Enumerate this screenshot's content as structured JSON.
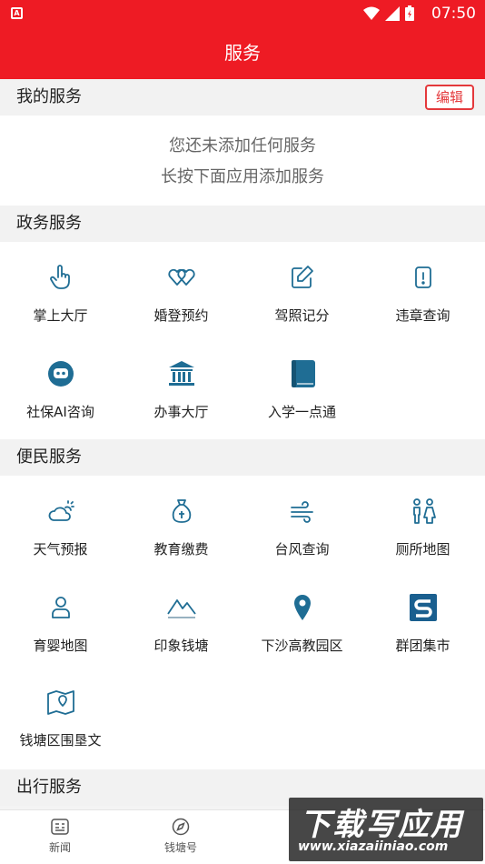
{
  "status_bar": {
    "time": "07:50",
    "sim_glyph": "A"
  },
  "header": {
    "title": "服务"
  },
  "my_services": {
    "title": "我的服务",
    "edit_label": "编辑",
    "empty_line1": "您还未添加任何服务",
    "empty_line2": "长按下面应用添加服务"
  },
  "gov_services": {
    "title": "政务服务",
    "items": [
      {
        "label": "掌上大厅",
        "icon": "hand-pointer-icon"
      },
      {
        "label": "婚登预约",
        "icon": "double-heart-icon"
      },
      {
        "label": "驾照记分",
        "icon": "edit-note-icon"
      },
      {
        "label": "违章查询",
        "icon": "alert-card-icon"
      },
      {
        "label": "社保AI咨询",
        "icon": "robot-icon"
      },
      {
        "label": "办事大厅",
        "icon": "government-building-icon"
      },
      {
        "label": "入学一点通",
        "icon": "book-icon"
      }
    ]
  },
  "convenience_services": {
    "title": "便民服务",
    "items": [
      {
        "label": "天气预报",
        "icon": "weather-icon"
      },
      {
        "label": "教育缴费",
        "icon": "money-bag-icon"
      },
      {
        "label": "台风查询",
        "icon": "wind-icon"
      },
      {
        "label": "厕所地图",
        "icon": "restroom-icon"
      },
      {
        "label": "育婴地图",
        "icon": "person-pin-icon"
      },
      {
        "label": "印象钱塘",
        "icon": "mountain-icon"
      },
      {
        "label": "下沙高教园区",
        "icon": "location-pin-icon"
      },
      {
        "label": "群团集市",
        "icon": "brand-s-icon"
      },
      {
        "label": "钱塘区围垦文",
        "icon": "map-pin-icon"
      }
    ]
  },
  "travel_services": {
    "title": "出行服务"
  },
  "tab_bar": {
    "tabs": [
      {
        "label": "新闻",
        "icon": "news-icon"
      },
      {
        "label": "钱塘号",
        "icon": "compass-icon"
      }
    ]
  },
  "watermark": {
    "text": "下载写应用",
    "url": "www.xiazaiiniao.com"
  },
  "colors": {
    "brand_red": "#ee1b24",
    "icon_teal": "#1f6d94"
  }
}
